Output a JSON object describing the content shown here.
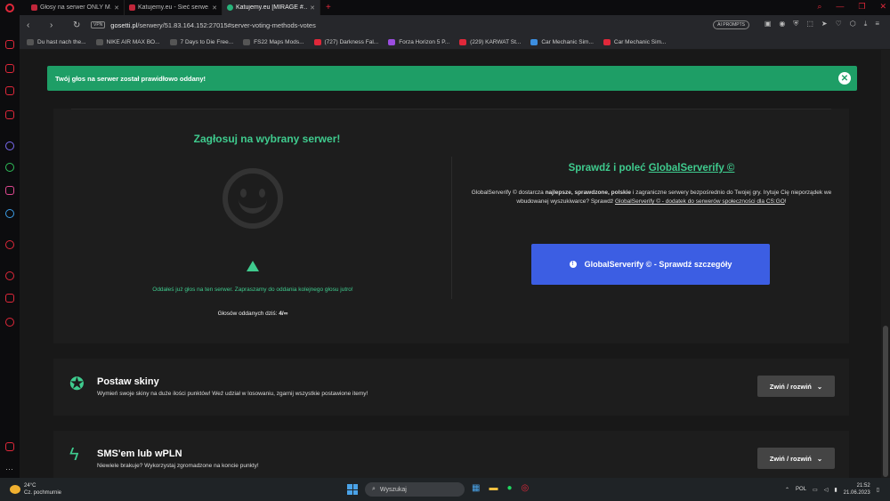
{
  "browser": {
    "tabs": [
      {
        "title": "Głosy na serwer ONLY M…",
        "active": false
      },
      {
        "title": "Katujemy.eu - Sieć serwe…",
        "active": false
      },
      {
        "title": "Katujemy.eu [MIRAGE #…",
        "active": true
      }
    ],
    "new_tab": "+",
    "vpn_label": "VPN",
    "url_host": "gosetti.pl",
    "url_path": "/serwery/51.83.164.152:27015#server-voting-methods-votes",
    "ai_badge": "AI PROMPTS",
    "bookmarks": [
      "Du hast nach the...",
      "NIKE AIR MAX BO...",
      "7 Days to Die Free...",
      "FS22 Maps Mods...",
      "(727) Darkness Fal...",
      "Forza Horizon 5 P...",
      "(229) KARWAT St...",
      "Car Mechanic Sim...",
      "Car Mechanic Sim..."
    ]
  },
  "alert": {
    "text": "Twój głos na serwer został prawidłowo oddany!",
    "close": "✕"
  },
  "vote": {
    "title": "Zagłosuj na wybrany serwer!",
    "warning": "Oddałeś już głos na ten serwer. Zapraszamy do oddania kolejnego głosu jutro!",
    "votes_label": "Głosów oddanych dziś:",
    "votes_value": "4/∞"
  },
  "globalserverify": {
    "title_prefix": "Sprawdź i poleć",
    "title_link": "GlobalServerify ©",
    "desc_1": "GlobalServerify © dostarcza",
    "desc_bold_1": "najlepsze, sprawdzone, polskie",
    "desc_2": "i zagraniczne serwery bezpośrednio do Twojej gry. Irytuje Cię nieporządek we wbudowanej wyszukiwarce? Sprawdź",
    "desc_link": "GlobalServerify © - dodatek do serwerów społeczności dla CS:GO",
    "desc_end": "!",
    "button": "GlobalServerify © - Sprawdź szczegóły"
  },
  "cards": [
    {
      "title": "Postaw skiny",
      "desc": "Wymień swoje skiny na duże ilości punktów! Weź udział w losowaniu, zgarnij wszystkie postawione itemy!",
      "button": "Zwiń / rozwiń"
    },
    {
      "title": "SMS'em lub wPLN",
      "desc": "Niewiele brakuje? Wykorzystaj zgromadzone na koncie punkty!",
      "button": "Zwiń / rozwiń"
    }
  ],
  "taskbar": {
    "temp": "24°C",
    "weather": "Cz. pochmurnie",
    "search": "Wyszukaj",
    "lang": "POL",
    "time": "21:52",
    "date": "21.06.2023"
  },
  "colors": {
    "accent_green": "#3fcb8e",
    "alert_green": "#1e9e66",
    "button_blue": "#3c5ee3",
    "opera_red": "#e0283a"
  }
}
